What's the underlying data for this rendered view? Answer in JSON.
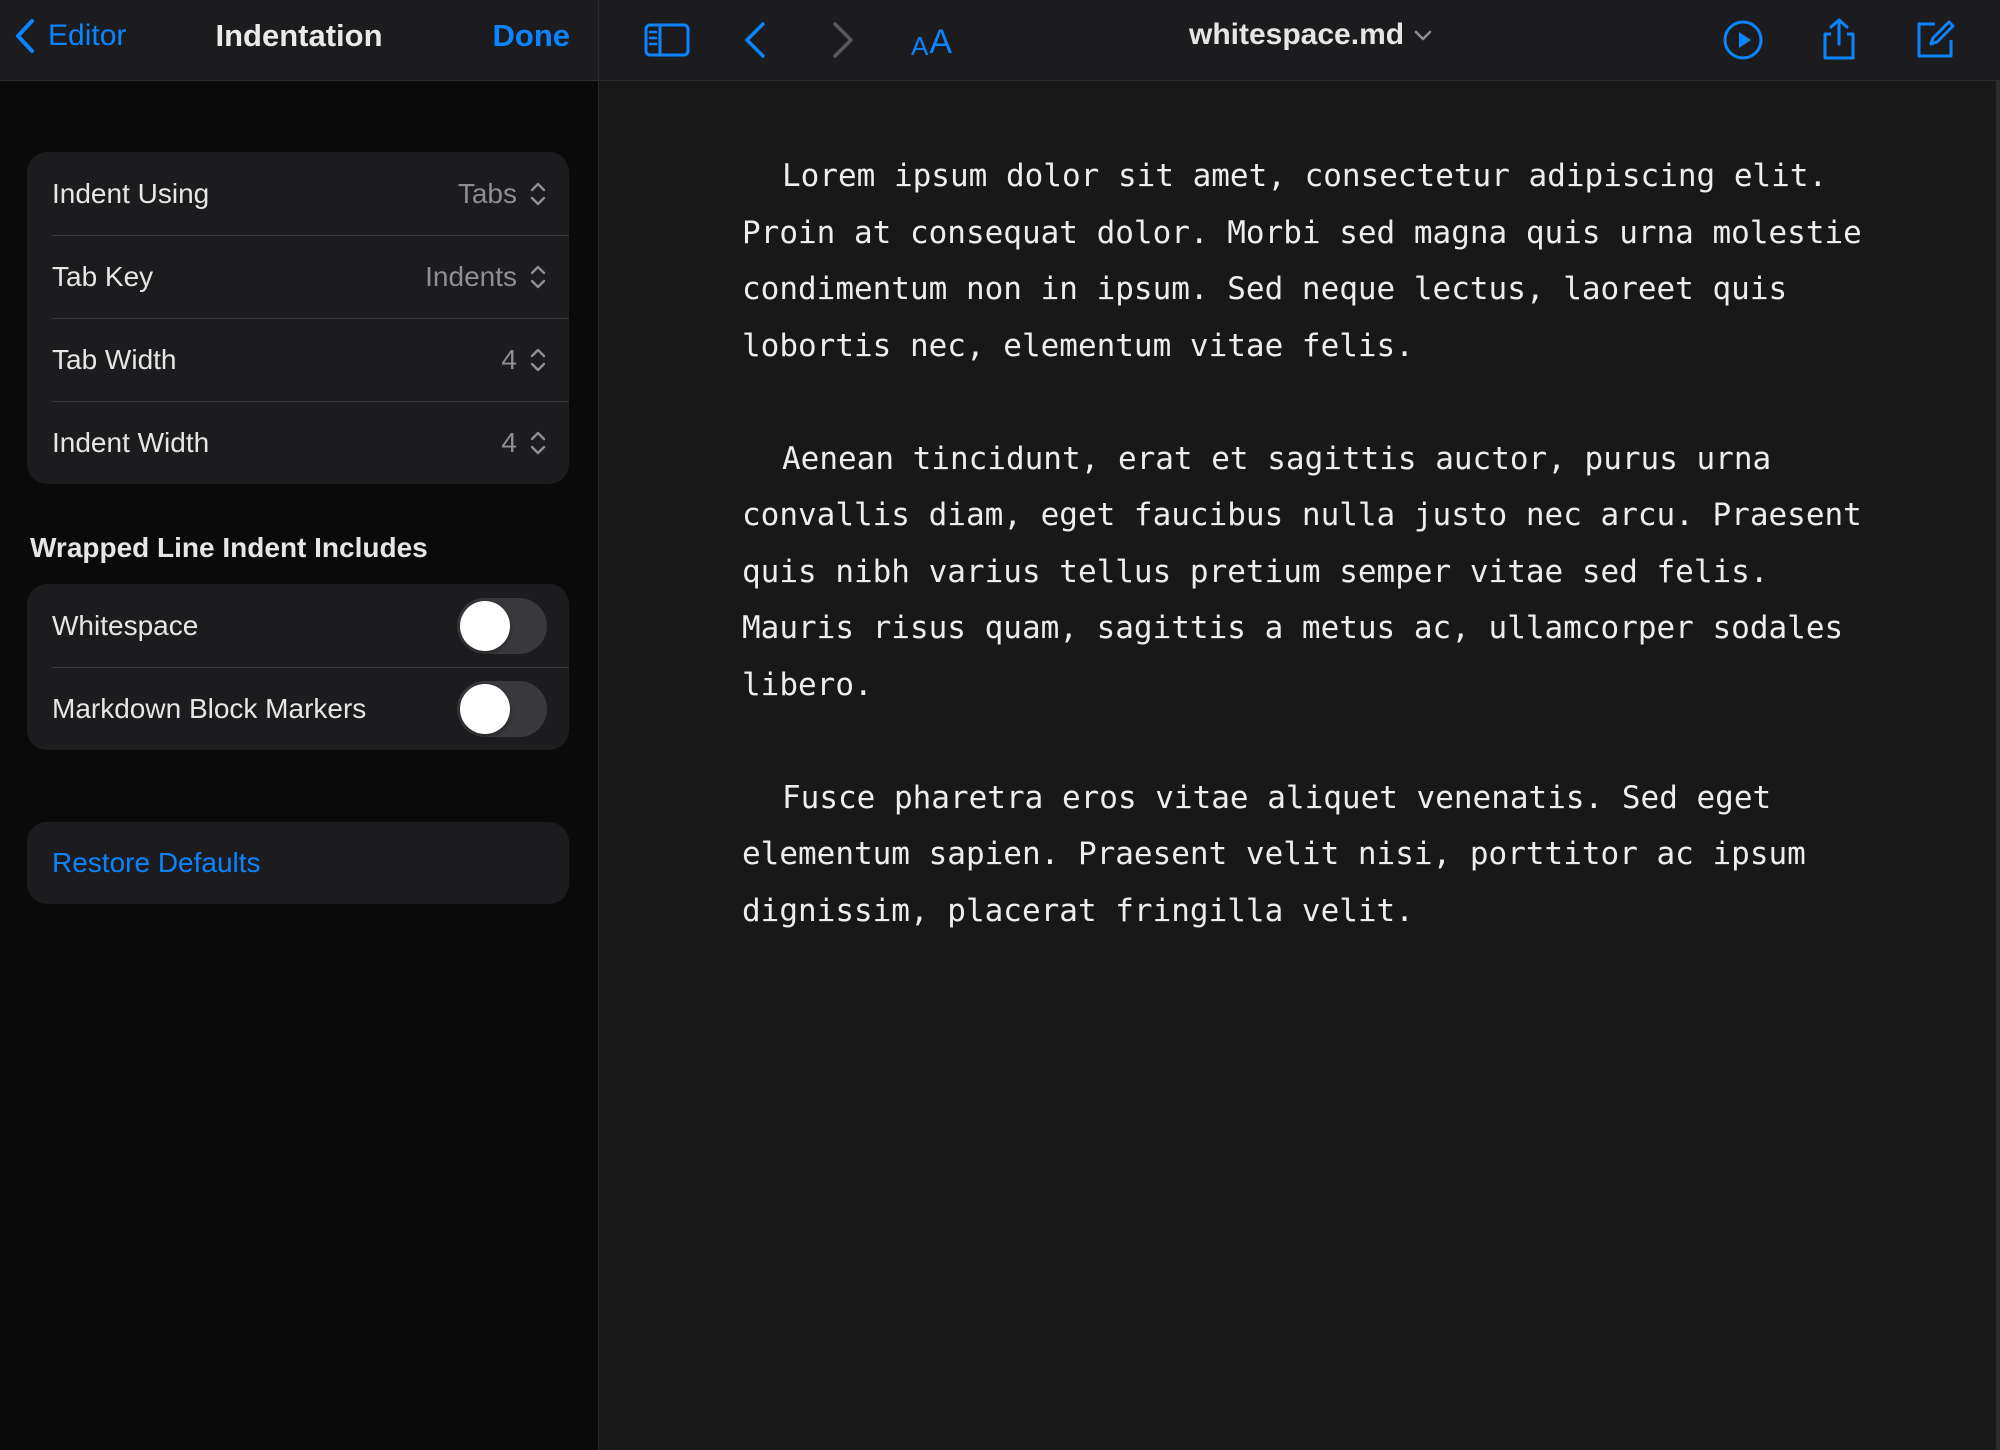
{
  "sidebar": {
    "nav": {
      "back_label": "Editor",
      "title": "Indentation",
      "done_label": "Done"
    },
    "indent_settings": [
      {
        "label": "Indent Using",
        "value": "Tabs"
      },
      {
        "label": "Tab Key",
        "value": "Indents"
      },
      {
        "label": "Tab Width",
        "value": "4"
      },
      {
        "label": "Indent Width",
        "value": "4"
      }
    ],
    "wrapped_section": {
      "header": "Wrapped Line Indent Includes",
      "toggles": [
        {
          "label": "Whitespace",
          "on": false
        },
        {
          "label": "Markdown Block Markers",
          "on": false
        }
      ]
    },
    "restore_label": "Restore Defaults"
  },
  "toolbar": {
    "icons": [
      "sidebar-toggle-icon",
      "back-arrow-icon",
      "forward-arrow-icon",
      "font-size-icon",
      "play-icon",
      "share-icon",
      "compose-icon"
    ],
    "font_small": "A",
    "font_big": "A",
    "doc_title": "whitespace.md"
  },
  "document": {
    "paragraphs": [
      "Lorem ipsum dolor sit amet, consectetur adipiscing elit. Proin at consequat dolor. Morbi sed magna quis urna molestie condimentum non in ipsum. Sed neque lectus, laoreet quis lobortis nec, elementum vitae felis.",
      "Aenean tincidunt, erat et sagittis auctor, purus urna convallis diam, eget faucibus nulla justo nec arcu. Praesent quis nibh varius tellus pretium semper vitae sed felis. Mauris risus quam, sagittis a metus ac, ullamcorper sodales libero.",
      "Fusce pharetra eros vitae aliquet venenatis. Sed eget elementum sapien. Praesent velit nisi, porttitor ac ipsum dignissim, placerat fringilla velit."
    ]
  },
  "colors": {
    "accent": "#0a84ff",
    "sidebar_bg": "#0a0a0a",
    "group_bg": "#1c1c1e",
    "editor_bg": "#181818"
  }
}
